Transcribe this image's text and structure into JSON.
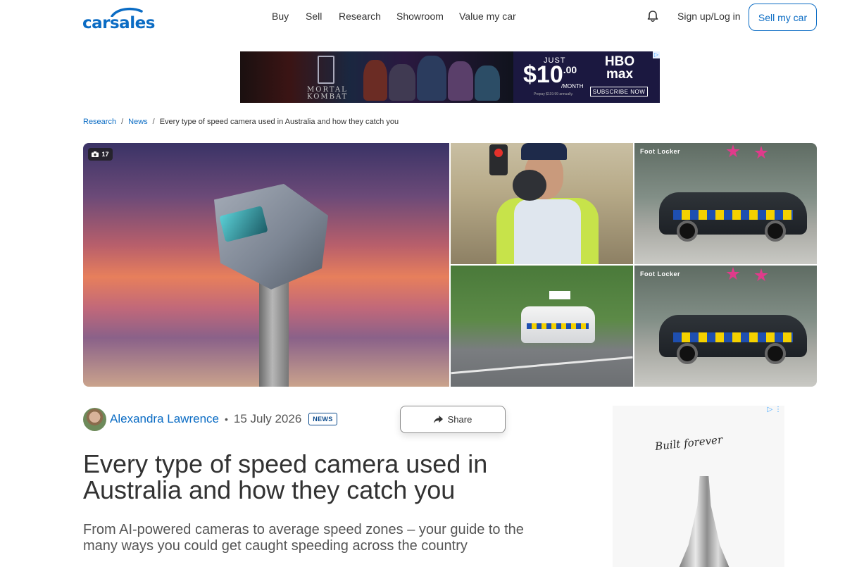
{
  "brand": {
    "logo_text": "carsales",
    "accent": "#0b6cc4"
  },
  "nav": {
    "items": [
      "Buy",
      "Sell",
      "Research",
      "Showroom",
      "Value my car"
    ]
  },
  "account": {
    "signin": "Sign up/Log in",
    "sell_button": "Sell my car"
  },
  "top_ad": {
    "poster_text": "MORTAL KOMBAT",
    "just": "JUST",
    "price_dollar": "$10",
    "price_cents": ".00",
    "per_month": "/MONTH",
    "fine_print": "Prepay $119.99 annually.",
    "brand": "HBO max",
    "cta": "SUBSCRIBE NOW"
  },
  "breadcrumb": {
    "items": [
      "Research",
      "News"
    ],
    "current": "Every type of speed camera used in Australia and how they catch you"
  },
  "gallery": {
    "photo_count": "17",
    "store_label": "Foot Locker"
  },
  "article": {
    "author": "Alexandra Lawrence",
    "separator": "•",
    "date": "15 July 2026",
    "badge": "NEWS",
    "share": "Share",
    "title": "Every type of speed camera used in Australia and how they catch you",
    "subtitle": "From AI-powered cameras to average speed zones – your guide to the many ways you could get caught speeding across the country"
  },
  "side_ad": {
    "signature": "Built forever"
  }
}
